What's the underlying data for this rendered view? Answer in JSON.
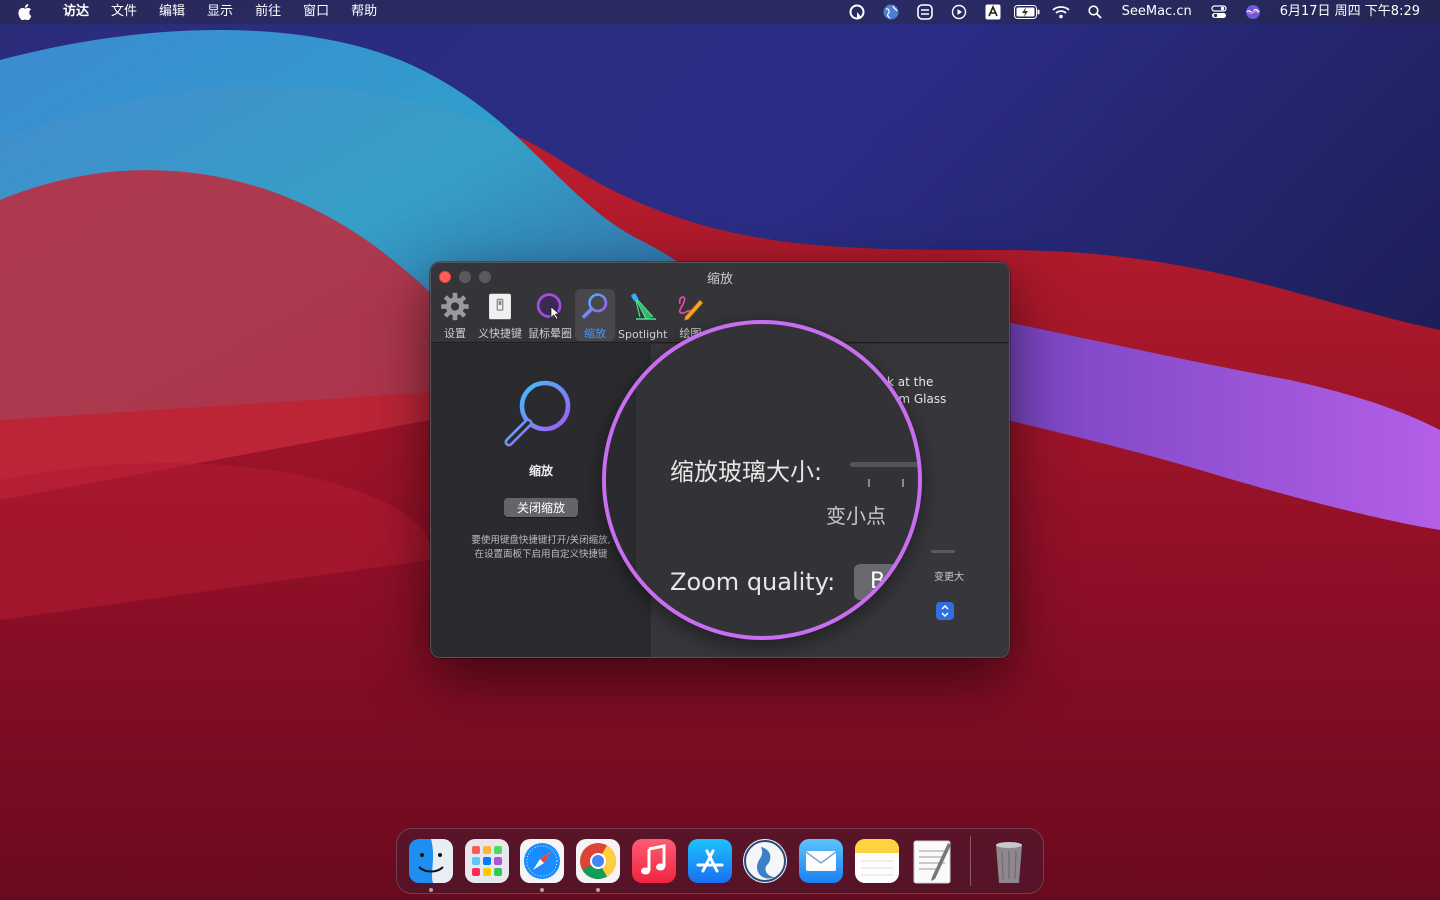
{
  "menubar": {
    "apple_icon": "apple-icon",
    "items": [
      "访达",
      "文件",
      "编辑",
      "显示",
      "前往",
      "窗口",
      "帮助"
    ],
    "site_label": "SeeMac.cn",
    "datetime": "6月17日 周四 下午8:29",
    "status_icons": [
      "cursor-pro-icon",
      "globe-icon",
      "clipboard-icon",
      "play-icon",
      "input-source-a-icon",
      "battery-charging-icon",
      "wifi-icon",
      "search-icon",
      "control-center-icon",
      "siri-icon"
    ]
  },
  "window": {
    "title": "缩放",
    "toolbar": [
      {
        "label": "设置",
        "icon": "gear-icon"
      },
      {
        "label": "义快捷键",
        "icon": "switch-icon"
      },
      {
        "label": "鼠标晕圈",
        "icon": "cursor-halo-icon"
      },
      {
        "label": "缩放",
        "icon": "magnifier-icon",
        "selected": true
      },
      {
        "label": "Spotlight",
        "icon": "spotlight-icon"
      },
      {
        "label": "绘图",
        "icon": "pen-icon"
      }
    ],
    "sidebar": {
      "feature_name": "缩放",
      "toggle_button": "关闭缩放",
      "hint_line1": "要使用键盘快捷键打开/关闭缩放,",
      "hint_line2": "在设置面板下启用自定义快捷键"
    },
    "pane": {
      "desc_line1": "k at the",
      "desc_line2": "om Glass",
      "slider_max_label": "变更大"
    }
  },
  "magnifier": {
    "size_label": "缩放玻璃大小:",
    "smaller_label": "变小点",
    "quality_label": "Zoom quality:",
    "quality_value": "B"
  },
  "dock": {
    "apps": [
      "finder-icon",
      "launchpad-icon",
      "safari-icon",
      "chrome-icon",
      "music-icon",
      "app-store-icon",
      "cursor-pro-icon",
      "mail-icon",
      "notes-icon",
      "textedit-icon"
    ],
    "trash": "trash-icon",
    "accent": "#c86ef0"
  }
}
